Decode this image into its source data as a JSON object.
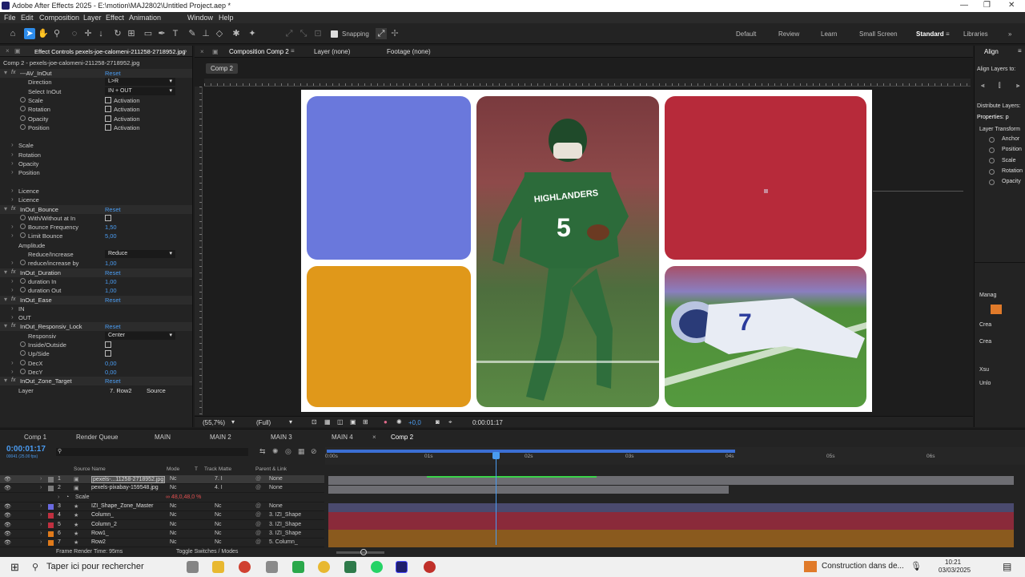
{
  "titlebar": {
    "title": "Adobe After Effects 2025 - E:\\motion\\MAJ2802\\Untitled Project.aep *",
    "minimize": "—",
    "maximize": "❐",
    "close": "✕"
  },
  "menu": [
    "File",
    "Edit",
    "Composition",
    "Layer",
    "Effect",
    "Animation",
    "Window",
    "Help"
  ],
  "toolbar": {
    "snapping": "Snapping",
    "workspaces": [
      "Default",
      "Review",
      "Learn",
      "Small Screen",
      "Standard",
      "Libraries"
    ],
    "active_workspace": "Standard"
  },
  "effect_controls": {
    "tab": "Effect Controls pexels-joe-calomeni-211258-2718952.jpg",
    "subtitle": "Comp 2 - pexels-joe-calomeni-211258-2718952.jpg",
    "rows": [
      {
        "type": "fx",
        "name": "---AV_InOut",
        "value": "Reset"
      },
      {
        "type": "dropdown",
        "name": "Direction",
        "value": "L>R"
      },
      {
        "type": "dropdown",
        "name": "Select InOut",
        "value": "IN + OUT"
      },
      {
        "type": "check",
        "name": "Scale",
        "value": "Activation"
      },
      {
        "type": "check",
        "name": "Rotation",
        "value": "Activation"
      },
      {
        "type": "check",
        "name": "Opacity",
        "value": "Activation"
      },
      {
        "type": "check",
        "name": "Position",
        "value": "Activation"
      },
      {
        "type": "blank"
      },
      {
        "type": "group",
        "name": "Scale"
      },
      {
        "type": "group",
        "name": "Rotation"
      },
      {
        "type": "group",
        "name": "Opacity"
      },
      {
        "type": "group",
        "name": "Position"
      },
      {
        "type": "blank"
      },
      {
        "type": "group",
        "name": "Licence"
      },
      {
        "type": "group",
        "name": "Licence"
      },
      {
        "type": "fx",
        "name": "InOut_Bounce",
        "value": "Reset"
      },
      {
        "type": "checkonly",
        "name": "With/Without at In"
      },
      {
        "type": "num",
        "name": "Bounce Frequency",
        "value": "1,50"
      },
      {
        "type": "num",
        "name": "Limit Bounce",
        "value": "5,00"
      },
      {
        "type": "label",
        "name": "Amplitude"
      },
      {
        "type": "dropdown",
        "name": "Reduce/Increase",
        "value": "Reduce"
      },
      {
        "type": "num",
        "name": "reduce/increase by",
        "value": "1,00"
      },
      {
        "type": "fx",
        "name": "InOut_Duration",
        "value": "Reset"
      },
      {
        "type": "num",
        "name": "duration In",
        "value": "1,00"
      },
      {
        "type": "num",
        "name": "duration Out",
        "value": "1,00"
      },
      {
        "type": "fx",
        "name": "InOut_Ease",
        "value": "Reset"
      },
      {
        "type": "group",
        "name": "IN"
      },
      {
        "type": "group",
        "name": "OUT"
      },
      {
        "type": "fx",
        "name": "InOut_Responsiv_Lock",
        "value": "Reset"
      },
      {
        "type": "dropdown",
        "name": "Responsiv",
        "value": "Center"
      },
      {
        "type": "checkonly",
        "name": "Inside/Outside"
      },
      {
        "type": "checkonly",
        "name": "Up/Side"
      },
      {
        "type": "num",
        "name": "DecX",
        "value": "0,00"
      },
      {
        "type": "num",
        "name": "DecY",
        "value": "0,00"
      },
      {
        "type": "fx",
        "name": "InOut_Zone_Target",
        "value": "Reset"
      },
      {
        "type": "layer",
        "name": "Layer",
        "value": "7. Row2",
        "source": "Source"
      }
    ]
  },
  "viewer": {
    "tabs": [
      "Composition Comp 2",
      "Layer (none)",
      "Footage (none)"
    ],
    "comp_chip": "Comp 2",
    "zoom": "(55,7%)",
    "resolution": "(Full)",
    "exposure": "+0,0",
    "timecode": "0:00:01:17",
    "jersey_text": "HIGHLANDERS",
    "jersey_number": "5",
    "player2_number": "7"
  },
  "colors": {
    "blue_tile": "#6a78dc",
    "orange_tile": "#e0981a",
    "red_tile": "#b72a3a",
    "jersey": "#2c6b3a",
    "field": "#4f8e3a"
  },
  "right_panel": {
    "align_title": "Align",
    "align_to": "Align Layers to:",
    "distribute": "Distribute Layers:",
    "properties": "Properties: p",
    "layer_transform": "Layer Transform",
    "props": [
      "Anchor",
      "Position",
      "Scale",
      "Rotation",
      "Opacity"
    ],
    "lower": [
      "Manag",
      "Crea",
      "Crea",
      "Xsu",
      "Unlo"
    ]
  },
  "timeline": {
    "tabs": [
      "Comp 1",
      "Render Queue",
      "MAIN",
      "MAIN 2",
      "MAIN 3",
      "MAIN 4",
      "Comp 2"
    ],
    "timecode": "0:00:01:17",
    "fps": "00041 (25.00 fps)",
    "cols": [
      "Source Name",
      "Mode",
      "T",
      "Track Matte",
      "Parent & Link"
    ],
    "ruler": [
      "0:00s",
      "01s",
      "02s",
      "03s",
      "04s",
      "05s",
      "06s"
    ],
    "layers": [
      {
        "num": "1",
        "name": "pexels-...11258-2718952.jpg",
        "mode": "Nc",
        "matte": "7. I",
        "parent": "None"
      },
      {
        "num": "2",
        "name": "pexels-pixabay-159548.jpg",
        "mode": "Nc",
        "matte": "4. I",
        "parent": "None"
      },
      {
        "num": "",
        "name": "Scale",
        "mode": "",
        "matte": "",
        "parent": ""
      },
      {
        "num": "3",
        "name": "IZI_Shape_Zone_Master",
        "mode": "Nc",
        "matte": "Nc",
        "parent": "None"
      },
      {
        "num": "4",
        "name": "Column_",
        "mode": "Nc",
        "matte": "Nc",
        "parent": "3. IZI_Shape"
      },
      {
        "num": "5",
        "name": "Column_2",
        "mode": "Nc",
        "matte": "Nc",
        "parent": "3. IZI_Shape"
      },
      {
        "num": "6",
        "name": "Row1_",
        "mode": "Nc",
        "matte": "Nc",
        "parent": "3. IZI_Shape"
      },
      {
        "num": "7",
        "name": "Row2",
        "mode": "Nc",
        "matte": "Nc",
        "parent": "5. Column_"
      }
    ],
    "scale_value": "∞ 48,0,48,0 %",
    "footer_left": "Frame Render Time: 95ms",
    "footer_mid": "Toggle Switches / Modes"
  },
  "taskbar": {
    "search": "Taper ici pour rechercher",
    "notification": "Construction dans de...",
    "time": "10:21",
    "date": "03/03/2025"
  }
}
